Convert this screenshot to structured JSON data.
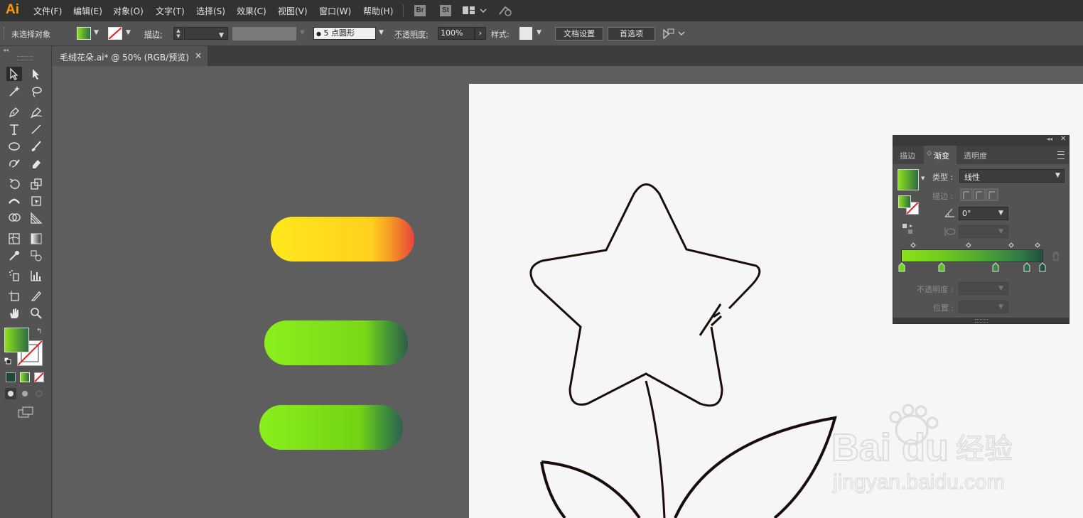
{
  "app": {
    "logo": "Ai"
  },
  "menu": [
    "文件(F)",
    "编辑(E)",
    "对象(O)",
    "文字(T)",
    "选择(S)",
    "效果(C)",
    "视图(V)",
    "窗口(W)",
    "帮助(H)"
  ],
  "menubar_buttons": {
    "bridge": "Br",
    "stock": "St"
  },
  "control_bar": {
    "selection_status": "未选择对象",
    "stroke_label": "描边",
    "brush_value": "5 点圆形",
    "opacity_label": "不透明度",
    "opacity_value": "100%",
    "style_label": "样式",
    "doc_setup": "文档设置",
    "preferences": "首选项"
  },
  "document_tab": {
    "title": "毛绒花朵.ai* @ 50% (RGB/预览)",
    "close": "×"
  },
  "gradient_panel": {
    "tabs": [
      "描边",
      "渐变",
      "透明度"
    ],
    "active_tab": 1,
    "type_label": "类型",
    "type_value": "线性",
    "stroke_label": "描边",
    "angle_value": "0°",
    "opacity_label": "不透明度",
    "position_label": "位置"
  },
  "colors": {
    "menubar_bg": "#323232",
    "panel_bg": "#535353",
    "canvas_bg": "#5e5e5e",
    "artboard": "#f6f6f6",
    "accent": "#ff9a00",
    "fill_gradient_start": "#8be21a",
    "fill_gradient_end": "#2d6b45",
    "yellow_start": "#ffe81c",
    "yellow_end": "#e9433c"
  }
}
